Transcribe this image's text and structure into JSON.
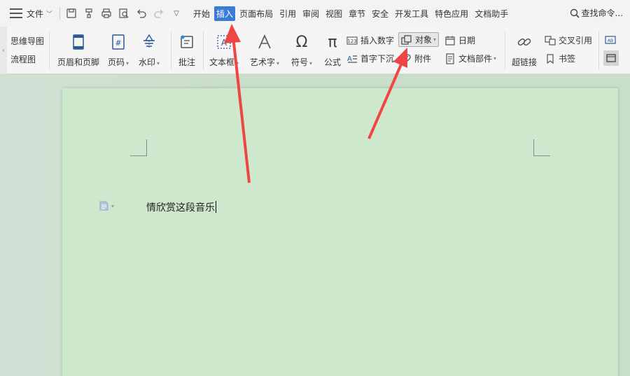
{
  "menubar": {
    "file_label": "文件",
    "tabs": [
      "开始",
      "插入",
      "页面布局",
      "引用",
      "审阅",
      "视图",
      "章节",
      "安全",
      "开发工具",
      "特色应用",
      "文档助手"
    ],
    "active_tab": "插入",
    "search_label": "查找命令..."
  },
  "ribbon": {
    "left": {
      "mindmap": "思维导图",
      "flowchart": "流程图"
    },
    "header_footer": "页眉和页脚",
    "page_number": "页码",
    "watermark": "水印",
    "comment": "批注",
    "textbox": "文本框",
    "wordart": "艺术字",
    "symbol": "符号",
    "formula": "公式",
    "insert_number": "插入数字",
    "dropcap": "首字下沉",
    "object": "对象",
    "attachment": "附件",
    "date": "日期",
    "doc_parts": "文档部件",
    "hyperlink": "超链接",
    "cross_ref": "交叉引用",
    "bookmark": "书签"
  },
  "document": {
    "text": "情欣赏这段音乐"
  },
  "colors": {
    "active_tab": "#3a7bd5",
    "page": "#cde8cd",
    "arrow": "#f04545"
  }
}
